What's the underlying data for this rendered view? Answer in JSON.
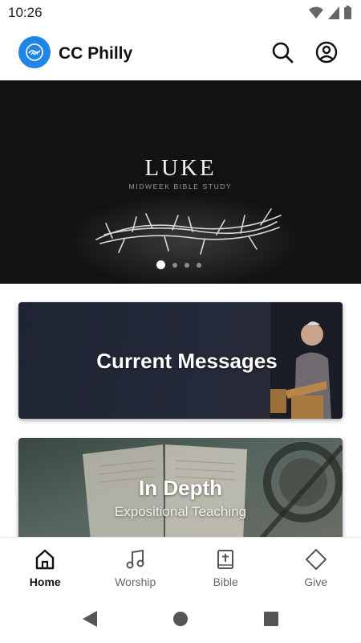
{
  "status_bar": {
    "time": "10:26"
  },
  "app_bar": {
    "title": "CC Philly"
  },
  "hero": {
    "title": "LUKE",
    "subtitle": "MIDWEEK BIBLE STUDY",
    "slide_count": 4,
    "active_slide": 1
  },
  "cards": {
    "messages": {
      "title": "Current Messages"
    },
    "depth": {
      "title": "In Depth",
      "subtitle": "Expositional Teaching"
    }
  },
  "bottom_nav": {
    "items": [
      {
        "label": "Home",
        "icon": "home-icon",
        "active": true
      },
      {
        "label": "Worship",
        "icon": "music-note-icon",
        "active": false
      },
      {
        "label": "Bible",
        "icon": "bible-icon",
        "active": false
      },
      {
        "label": "Give",
        "icon": "diamond-icon",
        "active": false
      }
    ]
  },
  "colors": {
    "brand_blue": "#1f86e8",
    "hero_bg": "#121212",
    "text_primary": "#111111",
    "text_secondary": "#666666"
  }
}
